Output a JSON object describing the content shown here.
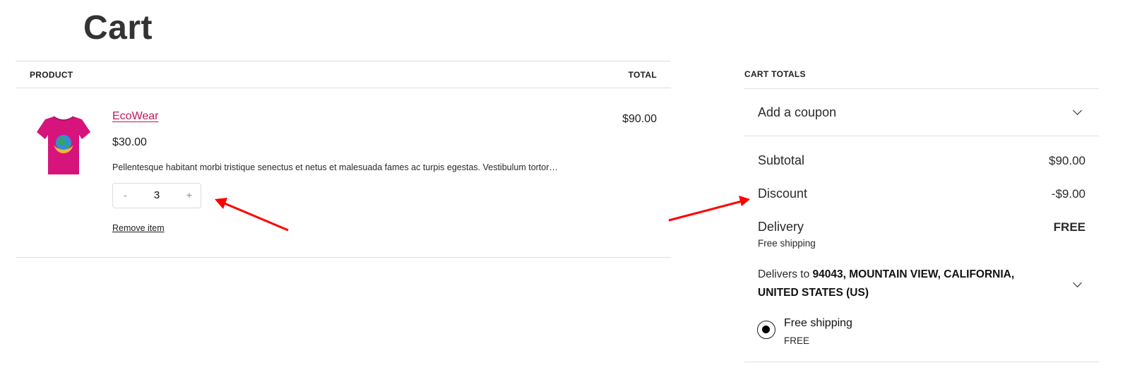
{
  "page": {
    "title": "Cart"
  },
  "table": {
    "product_header": "PRODUCT",
    "total_header": "TOTAL"
  },
  "item": {
    "name": "EcoWear",
    "price": "$30.00",
    "description": "Pellentesque habitant morbi tristique senectus et netus et malesuada fames ac turpis egestas. Vestibulum tortor…",
    "quantity": "3",
    "minus": "-",
    "plus": "+",
    "remove_label": "Remove item",
    "line_total": "$90.00"
  },
  "totals": {
    "header": "CART TOTALS",
    "coupon_label": "Add a coupon",
    "subtotal_label": "Subtotal",
    "subtotal_value": "$90.00",
    "discount_label": "Discount",
    "discount_value": "-$9.00",
    "delivery_label": "Delivery",
    "delivery_value": "FREE",
    "delivery_note": "Free shipping",
    "delivers_prefix": "Delivers to",
    "delivers_address": "94043, MOUNTAIN VIEW, CALIFORNIA, UNITED STATES (US)",
    "shipping_option_name": "Free shipping",
    "shipping_option_price": "FREE"
  },
  "colors": {
    "product_link": "#c2185b",
    "tshirt": "#d6147c",
    "annotation_arrow": "#ff0000"
  },
  "icons": {
    "coupon_toggle": "chevron-down-icon",
    "delivers_toggle": "chevron-down-icon",
    "product_image": "tshirt-icon"
  }
}
